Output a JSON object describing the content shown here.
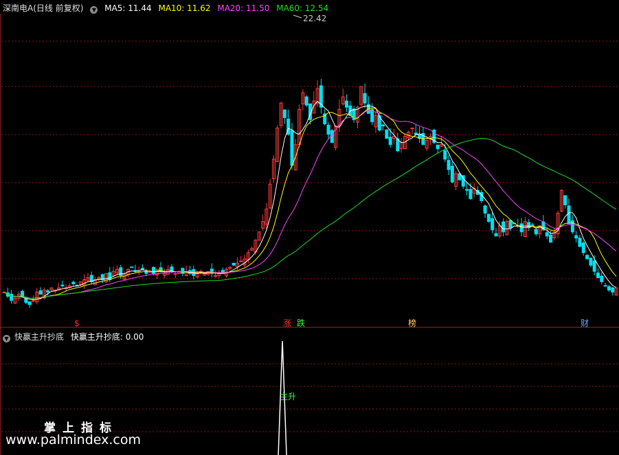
{
  "header": {
    "symbol": "深南电A(日线 前复权)",
    "ma5": "MA5: 11.44",
    "ma10": "MA10: 11.62",
    "ma20": "MA20: 11.50",
    "ma60": "MA60: 12.54",
    "high_label": "22.42"
  },
  "indicator": {
    "name": "快赢主升抄底",
    "value_label": "快赢主升抄底: 0.00",
    "signal_label": "主升"
  },
  "markers": [
    {
      "text": "$",
      "color": "#ff3030"
    },
    {
      "text": "涨",
      "color": "#ff3030"
    },
    {
      "text": "跌",
      "color": "#33ff33"
    },
    {
      "text": "榜",
      "color": "#ffcc66"
    },
    {
      "text": "财",
      "color": "#66aaff"
    }
  ],
  "watermark": {
    "line1": "掌上指标",
    "line2": "www.palmindex.com"
  },
  "colors": {
    "up": "#ff3b3b",
    "down": "#00e0f0",
    "ma5": "#ffffff",
    "ma10": "#ffff00",
    "ma20": "#ff44ff",
    "ma60": "#22dd22",
    "grid": "#8b1a1a"
  },
  "chart_data": {
    "type": "candlestick",
    "price_range": [
      9.2,
      23.8
    ],
    "indicator_range": [
      0,
      1
    ],
    "closes": [
      10.4,
      10.2,
      10.0,
      10.1,
      10.3,
      10.2,
      9.9,
      9.8,
      10.0,
      10.4,
      10.3,
      10.5,
      10.4,
      10.6,
      10.5,
      10.6,
      10.7,
      10.6,
      10.7,
      10.8,
      10.7,
      10.9,
      11.0,
      11.1,
      10.9,
      11.0,
      11.1,
      11.0,
      11.3,
      11.0,
      11.4,
      11.5,
      11.2,
      11.3,
      11.5,
      11.6,
      11.4,
      11.4,
      11.5,
      11.3,
      11.4,
      11.3,
      11.5,
      11.4,
      11.3,
      11.5,
      11.4,
      11.3,
      11.4,
      11.3,
      11.4,
      11.3,
      11.2,
      11.3,
      11.4,
      11.3,
      11.4,
      11.3,
      11.2,
      11.3,
      11.3,
      11.5,
      11.6,
      11.7,
      11.8,
      11.9,
      12.0,
      12.3,
      12.5,
      12.9,
      13.3,
      13.8,
      14.4,
      15.6,
      16.8,
      18.3,
      19.5,
      18.8,
      18.0,
      16.5,
      17.5,
      19.2,
      20.0,
      19.4,
      18.7,
      19.6,
      20.2,
      19.3,
      18.5,
      18.0,
      17.6,
      18.4,
      19.2,
      19.8,
      19.3,
      18.9,
      18.7,
      19.3,
      20.3,
      19.5,
      19.0,
      18.6,
      18.9,
      18.2,
      18.4,
      17.8,
      17.5,
      17.9,
      17.2,
      17.6,
      17.9,
      18.1,
      18.3,
      18.0,
      17.8,
      17.5,
      17.7,
      17.9,
      17.6,
      17.3,
      17.5,
      16.8,
      16.3,
      15.7,
      16.1,
      15.8,
      15.5,
      15.3,
      14.9,
      15.4,
      15.1,
      14.8,
      14.2,
      13.8,
      13.4,
      13.1,
      13.6,
      13.3,
      13.8,
      13.5,
      13.7,
      13.6,
      13.3,
      13.8,
      13.5,
      13.6,
      13.2,
      13.6,
      13.4,
      13.1,
      12.8,
      13.3,
      14.2,
      15.3,
      14.6,
      13.7,
      13.3,
      13.0,
      12.6,
      12.3,
      12.0,
      11.7,
      11.4,
      11.1,
      10.9,
      10.7,
      10.5,
      10.4,
      10.6
    ],
    "highs_note": "Peak high printed on chart",
    "signal_index": 76
  }
}
